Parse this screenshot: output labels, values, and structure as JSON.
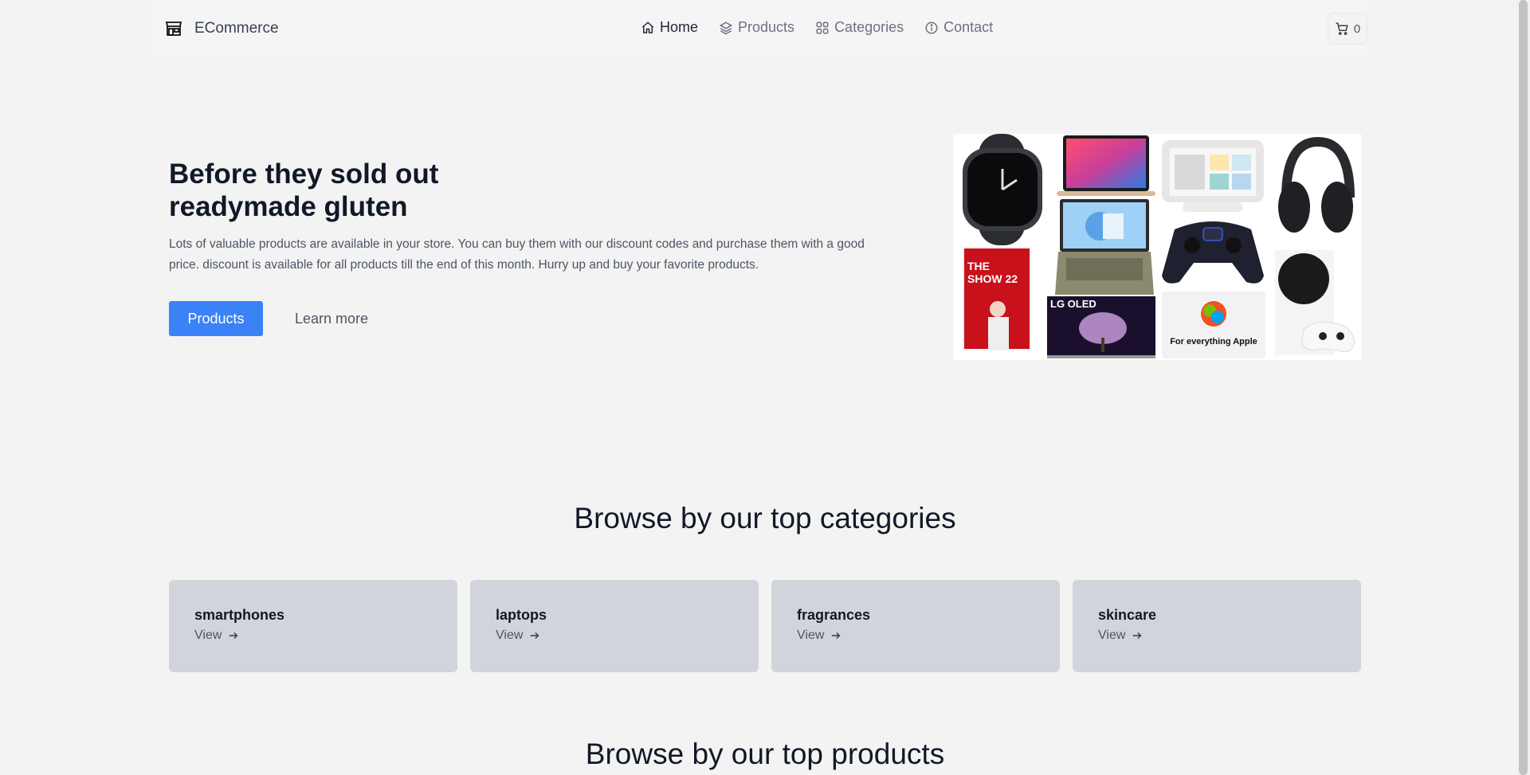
{
  "header": {
    "brand": "ECommerce",
    "nav": [
      {
        "label": "Home",
        "icon": "home-icon",
        "active": true
      },
      {
        "label": "Products",
        "icon": "layers-icon",
        "active": false
      },
      {
        "label": "Categories",
        "icon": "grid-icon",
        "active": false
      },
      {
        "label": "Contact",
        "icon": "info-icon",
        "active": false
      }
    ],
    "cart_count": "0"
  },
  "hero": {
    "title_line1": "Before they sold out",
    "title_line2": "readymade gluten",
    "text": "Lots of valuable products are available in your store. You can buy them with our discount codes and purchase them with a good price. discount is available for all products till the end of this month. Hurry up and buy your favorite products.",
    "primary_button": "Products",
    "secondary_link": "Learn more",
    "collage_labels": {
      "tv": "LG OLED",
      "apple_card": "For everything Apple",
      "game_title": "THE SHOW 22"
    }
  },
  "categories": {
    "title": "Browse by our top categories",
    "items": [
      {
        "name": "smartphones",
        "action": "View"
      },
      {
        "name": "laptops",
        "action": "View"
      },
      {
        "name": "fragrances",
        "action": "View"
      },
      {
        "name": "skincare",
        "action": "View"
      }
    ]
  },
  "products": {
    "title": "Browse by our top products"
  },
  "colors": {
    "accent": "#3b82f6",
    "background": "#f3f3f3",
    "card": "#d1d5db"
  }
}
